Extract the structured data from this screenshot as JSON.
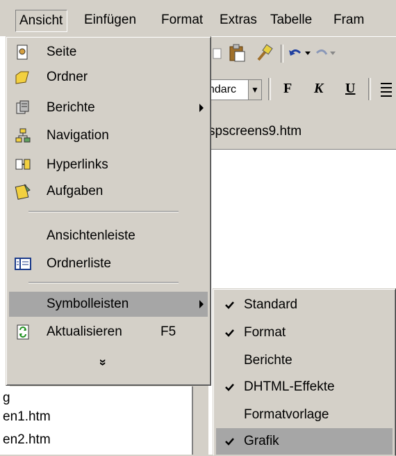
{
  "menubar": {
    "items": [
      {
        "label": "Ansicht",
        "active": true
      },
      {
        "label": "Einfügen"
      },
      {
        "label": "Format"
      },
      {
        "label": "Extras"
      },
      {
        "label": "Tabelle"
      },
      {
        "label": "Fram"
      }
    ]
  },
  "toolbar": {
    "font_select": "ndarc",
    "bold_label": "F",
    "italic_label": "K",
    "underline_label": "U"
  },
  "document": {
    "tab_title": "spscreens9.htm"
  },
  "left_pane": {
    "lines": [
      "g",
      "en1.htm",
      "en2.htm"
    ]
  },
  "view_menu": {
    "items": [
      {
        "label": "Seite",
        "icon": "page-icon"
      },
      {
        "label": "Ordner",
        "icon": "folder-icon"
      },
      {
        "label": "Berichte",
        "icon": "reports-icon",
        "submenu": true
      },
      {
        "label": "Navigation",
        "icon": "navigation-icon"
      },
      {
        "label": "Hyperlinks",
        "icon": "hyperlinks-icon"
      },
      {
        "label": "Aufgaben",
        "icon": "tasks-icon"
      },
      {
        "label": "Ansichtenleiste"
      },
      {
        "label": "Ordnerliste",
        "icon": "folder-list-icon"
      },
      {
        "label": "Symbolleisten",
        "submenu": true,
        "highlighted": true
      },
      {
        "label": "Aktualisieren",
        "shortcut": "F5",
        "icon": "refresh-icon"
      }
    ],
    "more_glyph": "»"
  },
  "toolbars_submenu": {
    "items": [
      {
        "label": "Standard",
        "checked": true
      },
      {
        "label": "Format",
        "checked": true
      },
      {
        "label": "Berichte",
        "checked": false
      },
      {
        "label": "DHTML-Effekte",
        "checked": true
      },
      {
        "label": "Formatvorlage",
        "checked": false
      },
      {
        "label": "Grafik",
        "checked": true,
        "highlighted": true
      }
    ]
  },
  "colors": {
    "face": "#d4d0c8",
    "highlight": "#a6a6a6",
    "shadow": "#808080"
  }
}
